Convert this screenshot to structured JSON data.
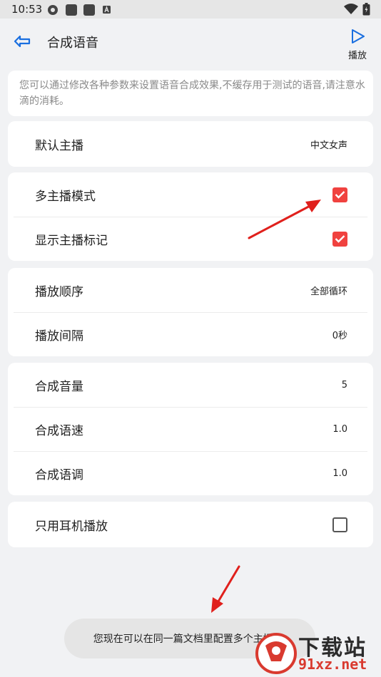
{
  "status_bar": {
    "time": "10:53"
  },
  "app_bar": {
    "title": "合成语音",
    "play_label": "播放"
  },
  "note": "您可以通过修改各种参数来设置语音合成效果,不缓存用于测试的语音,请注意水滴的消耗。",
  "settings": {
    "default_anchor": {
      "label": "默认主播",
      "value": "中文女声"
    },
    "multi_anchor_mode": {
      "label": "多主播模式",
      "checked": true
    },
    "show_anchor_mark": {
      "label": "显示主播标记",
      "checked": true
    },
    "play_order": {
      "label": "播放顺序",
      "value": "全部循环"
    },
    "play_interval": {
      "label": "播放间隔",
      "value": "0秒"
    },
    "volume": {
      "label": "合成音量",
      "value": "5"
    },
    "speed": {
      "label": "合成语速",
      "value": "1.0"
    },
    "pitch": {
      "label": "合成语调",
      "value": "1.0"
    },
    "headphone_only": {
      "label": "只用耳机播放",
      "checked": false
    }
  },
  "toast": "您现在可以在同一篇文档里配置多个主播了.",
  "watermark": {
    "title": "下载站",
    "url": "91xz.net"
  },
  "colors": {
    "accent_blue": "#1a6fe0",
    "checkbox_red": "#f0423f",
    "arrow_red": "#e0201c"
  }
}
